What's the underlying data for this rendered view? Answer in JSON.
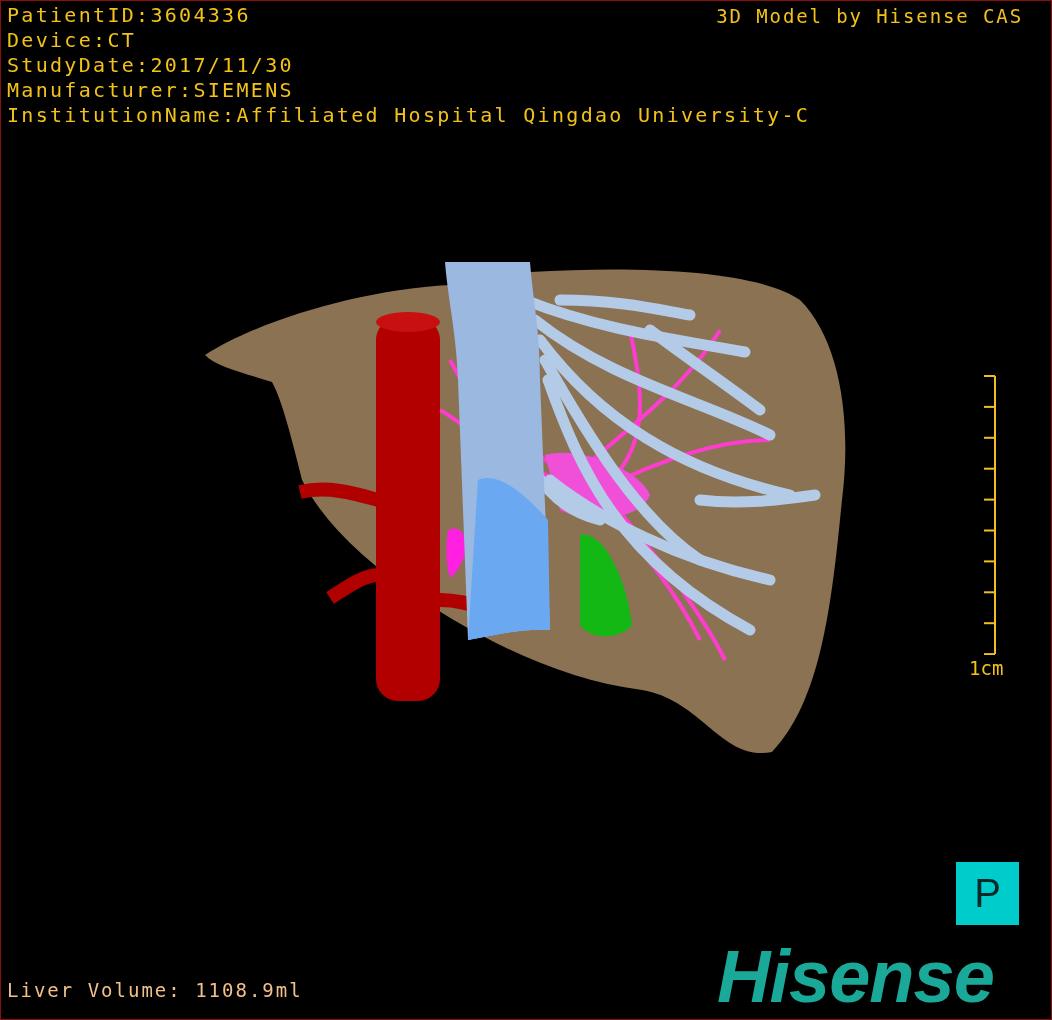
{
  "info_lines": [
    "PatientID:3604336",
    "Device:CT",
    "StudyDate:2017/11/30",
    "Manufacturer:SIEMENS",
    "InstitutionName:Affiliated Hospital Qingdao University-C"
  ],
  "credit": "3D Model by Hisense CAS",
  "scale_bar": {
    "label": "1cm"
  },
  "orientation_marker": "P",
  "liver_volume": "Liver Volume: 1108.9ml",
  "logo": "Hisense"
}
